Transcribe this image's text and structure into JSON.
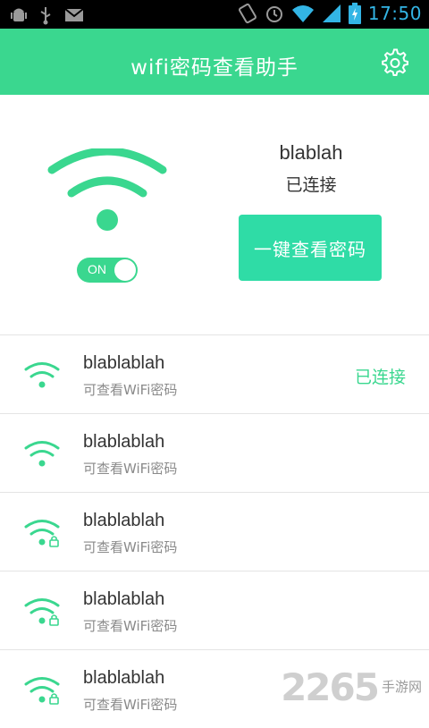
{
  "status_bar": {
    "time": "17:50",
    "left_icons": [
      "android-debug-icon",
      "usb-icon",
      "gmail-icon"
    ],
    "right_icons": [
      "rotate-icon",
      "alarm-icon",
      "wifi-signal-icon",
      "cell-signal-icon",
      "battery-charging-icon"
    ],
    "time_color": "#33b5e5"
  },
  "app_bar": {
    "title": "wifi密码查看助手",
    "settings_icon": "gear-icon",
    "background": "#3ad78f"
  },
  "current_network": {
    "name": "blablah",
    "status": "已连接",
    "toggle_label": "ON",
    "toggle_on": true,
    "view_button_label": "一键查看密码",
    "button_color": "#2fdca6"
  },
  "networks": [
    {
      "name": "blablablah",
      "subtitle": "可查看WiFi密码",
      "status": "已连接",
      "locked": false
    },
    {
      "name": "blablablah",
      "subtitle": "可查看WiFi密码",
      "status": "",
      "locked": false
    },
    {
      "name": "blablablah",
      "subtitle": "可查看WiFi密码",
      "status": "",
      "locked": true
    },
    {
      "name": "blablablah",
      "subtitle": "可查看WiFi密码",
      "status": "",
      "locked": true
    },
    {
      "name": "blablablah",
      "subtitle": "可查看WiFi密码",
      "status": "",
      "locked": true
    }
  ],
  "watermark": {
    "number": "2265",
    "text": "手游网"
  },
  "accent_color": "#3ad78f"
}
